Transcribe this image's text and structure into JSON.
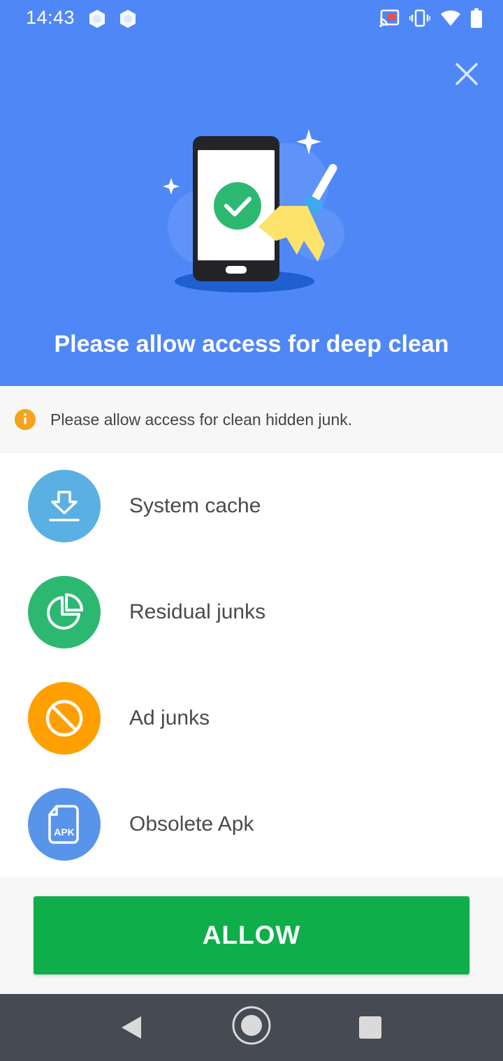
{
  "status_bar": {
    "time": "14:43",
    "left_icons": [
      "app-notification-icon",
      "app-notification-icon"
    ],
    "right_icons": [
      "cast-icon",
      "vibrate-icon",
      "wifi-icon",
      "battery-icon"
    ]
  },
  "header": {
    "close_icon": "close-icon",
    "illustration": "phone-cleaning-illustration",
    "title": "Please allow access for deep clean",
    "background_color": "#4f87f7"
  },
  "notice": {
    "icon": "info-icon",
    "text": "Please allow access for clean hidden junk."
  },
  "items": [
    {
      "label": "System cache",
      "icon": "download-icon",
      "color": "#5ab0e3"
    },
    {
      "label": "Residual junks",
      "icon": "pie-chart-icon",
      "color": "#2db872"
    },
    {
      "label": "Ad junks",
      "icon": "block-icon",
      "color": "#ffa000"
    },
    {
      "label": "Obsolete Apk",
      "icon": "apk-file-icon",
      "color": "#5895ea",
      "icon_text": "APK"
    }
  ],
  "action": {
    "allow_label": "ALLOW",
    "color": "#0fae4b"
  },
  "nav_bar": {
    "icons": [
      "back-icon",
      "home-icon",
      "recents-icon"
    ]
  }
}
